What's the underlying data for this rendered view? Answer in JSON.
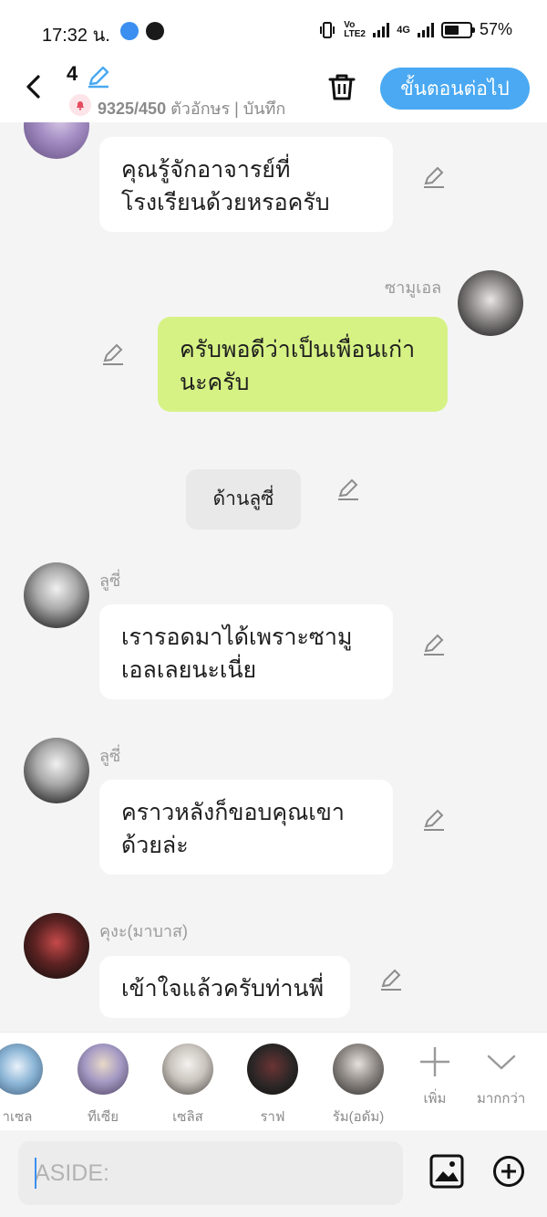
{
  "status_bar": {
    "time": "17:32 น.",
    "battery_percent": "57%",
    "battery_level": 0.57,
    "network_badge": "4G",
    "volte_badge": "Vo LTE2"
  },
  "header": {
    "episode_number": "4",
    "char_count": "9325/450",
    "char_unit": "ตัวอักษร | บันทึก",
    "next_button": "ขั้นตอนต่อไป"
  },
  "messages": [
    {
      "type": "left",
      "sender": "",
      "text_lines": [
        "คุณรู้จักอาจารย์ที่",
        "โรงเรียนด้วยหรอครับ"
      ]
    },
    {
      "type": "right",
      "sender": "ซามูเอล",
      "text_lines": [
        "ครับพอดีว่าเป็นเพื่อนเก่า",
        "นะครับ"
      ]
    },
    {
      "type": "center",
      "text": "ด้านลูซี่"
    },
    {
      "type": "left",
      "sender": "ลูซี่",
      "text_lines": [
        "เรารอดมาได้เพราะซามู",
        "เอลเลยนะเนี่ย"
      ]
    },
    {
      "type": "left",
      "sender": "ลูซี่",
      "text_lines": [
        "คราวหลังก็ขอบคุณเขา",
        "ด้วยล่ะ"
      ]
    },
    {
      "type": "left",
      "sender": "คุงะ(มาบาส)",
      "text_lines": [
        "เข้าใจแล้วครับท่านพี่"
      ]
    }
  ],
  "characters": [
    {
      "label": "าเซล",
      "color": "#8db6d6"
    },
    {
      "label": "ทีเซีย",
      "color": "#a59ac4"
    },
    {
      "label": "เซลิส",
      "color": "#c9c4bd"
    },
    {
      "label": "ราฟ",
      "color": "#2a2626"
    },
    {
      "label": "รัม(อดัม)",
      "color": "#8f8a86"
    }
  ],
  "char_actions": {
    "add_label": "เพิ่ม",
    "more_label": "มากกว่า"
  },
  "composer": {
    "placeholder": "ASIDE:"
  },
  "colors": {
    "accent": "#4aa9f2",
    "own_bubble": "#d6f285",
    "background": "#f4f4f4"
  }
}
